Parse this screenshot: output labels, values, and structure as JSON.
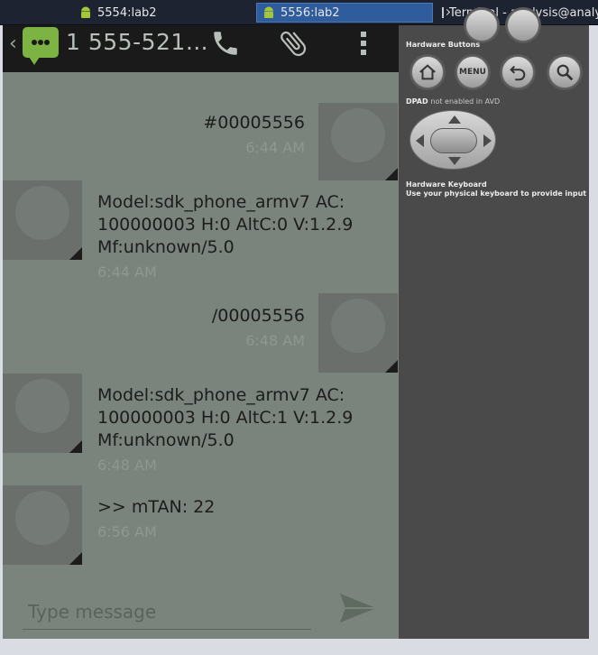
{
  "taskbar": {
    "tasks": [
      {
        "label": "5554:lab2",
        "icon": "android-icon",
        "active": false
      },
      {
        "label": "5556:lab2",
        "icon": "android-icon",
        "active": true
      },
      {
        "label": "Terminal - analysis@analys",
        "icon": "terminal-icon",
        "active": false
      }
    ]
  },
  "phone": {
    "actionbar": {
      "contact": "1 555-521…",
      "icons": [
        "back-chevron-icon",
        "messaging-app-icon",
        "call-icon",
        "attach-icon",
        "overflow-menu-icon"
      ]
    },
    "messages": [
      {
        "direction": "outgoing",
        "lines": [
          "#00005556"
        ],
        "time": "6:44 AM"
      },
      {
        "direction": "incoming",
        "lines": [
          "Model:sdk_phone_armv7 AC:",
          "100000003 H:0 AltC:0 V:1.2.9",
          "Mf:unknown/5.0"
        ],
        "time": "6:44 AM"
      },
      {
        "direction": "outgoing",
        "lines": [
          "/00005556"
        ],
        "time": "6:48 AM"
      },
      {
        "direction": "incoming",
        "lines": [
          "Model:sdk_phone_armv7 AC:",
          "100000003 H:0 AltC:1 V:1.2.9",
          "Mf:unknown/5.0"
        ],
        "time": "6:48 AM"
      },
      {
        "direction": "incoming",
        "lines": [
          ">> mTAN: 22"
        ],
        "time": "6:56 AM"
      }
    ],
    "composer": {
      "placeholder": "Type message",
      "send_icon": "send-icon"
    }
  },
  "controls": {
    "hardware_buttons_label": "Hardware Buttons",
    "buttons": [
      {
        "name": "home",
        "icon": "home-icon"
      },
      {
        "name": "menu",
        "label": "MENU"
      },
      {
        "name": "back",
        "icon": "back-icon"
      },
      {
        "name": "search",
        "icon": "search-icon"
      }
    ],
    "dpad_label": "DPAD",
    "dpad_note": "not enabled in AVD",
    "keyboard_label": "Hardware Keyboard",
    "keyboard_note": "Use your physical keyboard to provide input"
  },
  "colors": {
    "taskbar_bg": "#1d2330",
    "active_task": "#2f5c9c",
    "screen_bg": "#7a847c",
    "actionbar_bg": "#1a1a1a",
    "app_icon": "#7cb342",
    "controls_bg": "#4a4a4a"
  }
}
